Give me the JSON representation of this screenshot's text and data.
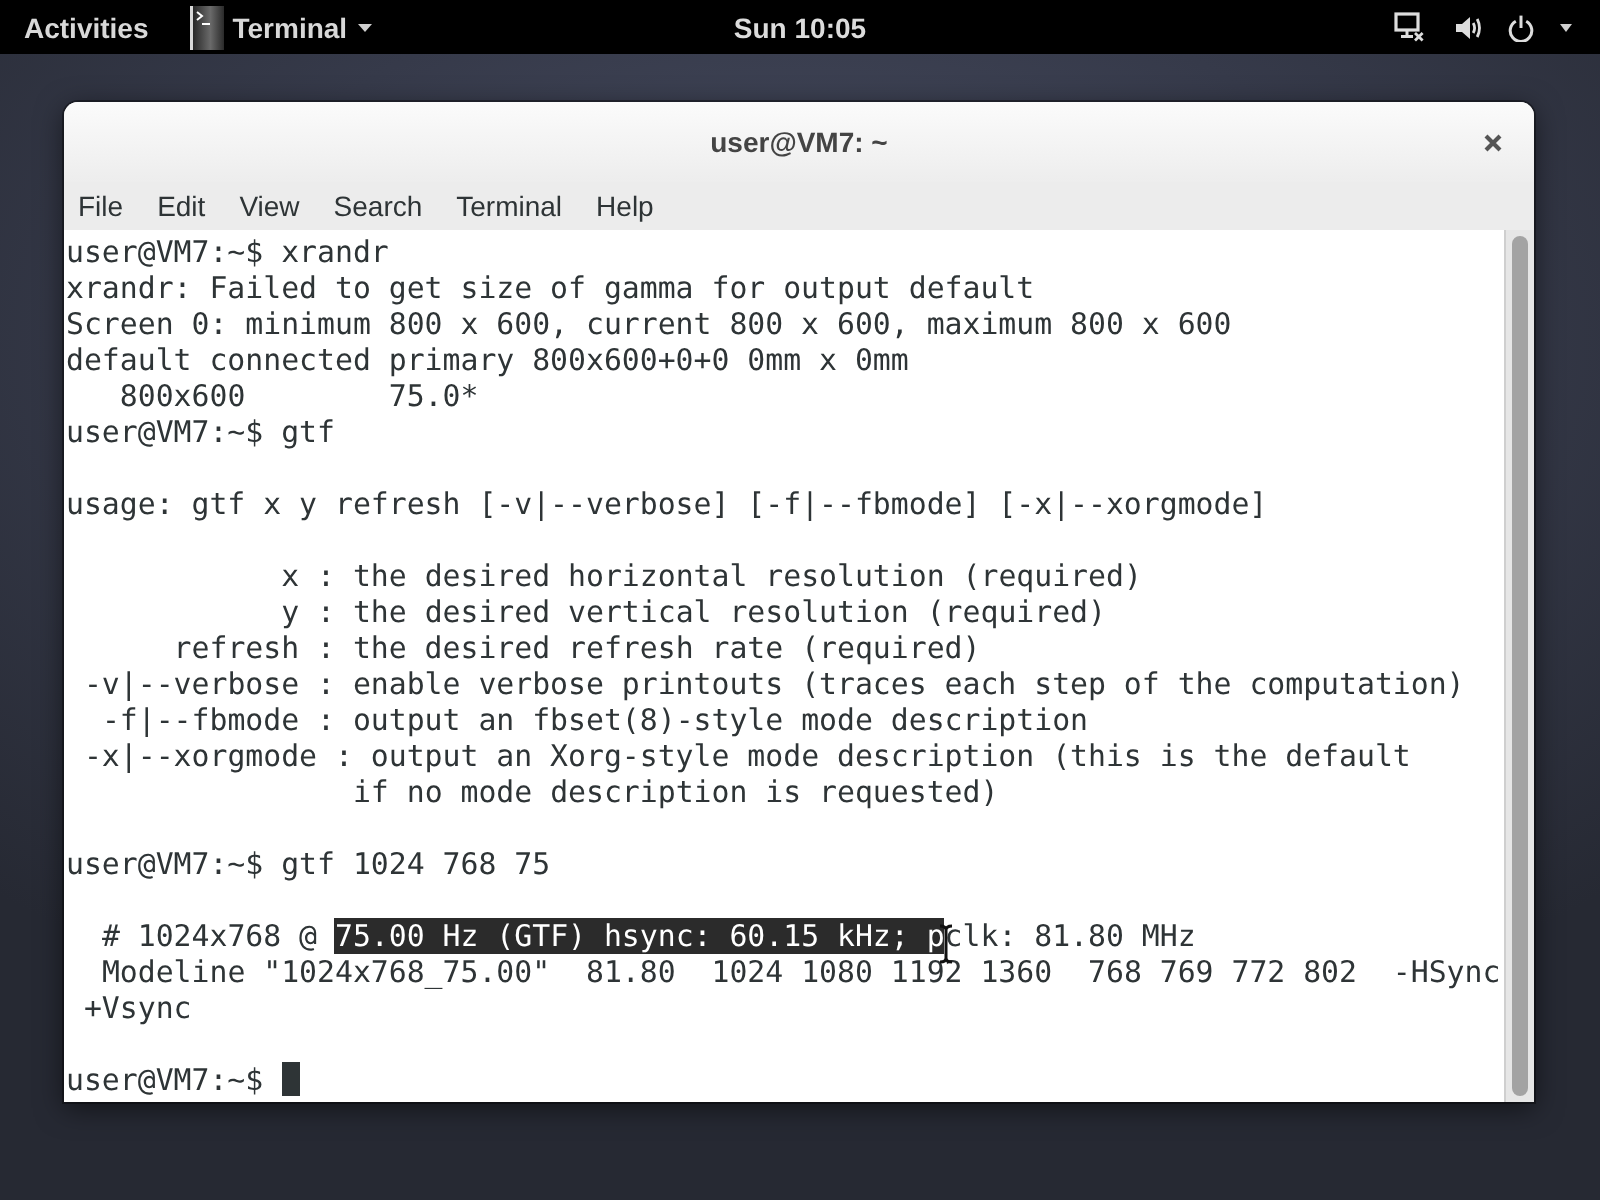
{
  "top_bar": {
    "activities": "Activities",
    "app_menu": "Terminal",
    "clock": "Sun 10:05"
  },
  "window": {
    "title": "user@VM7: ~",
    "menu": [
      "File",
      "Edit",
      "View",
      "Search",
      "Terminal",
      "Help"
    ],
    "terminal": {
      "blocks": [
        [
          "user@VM7:~$ xrandr",
          "xrandr: Failed to get size of gamma for output default",
          "Screen 0: minimum 800 x 600, current 800 x 600, maximum 800 x 600",
          "default connected primary 800x600+0+0 0mm x 0mm",
          "   800x600        75.0*",
          "user@VM7:~$ gtf"
        ],
        [
          "usage: gtf x y refresh [-v|--verbose] [-f|--fbmode] [-x|--xorgmode]"
        ],
        [
          "            x : the desired horizontal resolution (required)",
          "            y : the desired vertical resolution (required)",
          "      refresh : the desired refresh rate (required)",
          " -v|--verbose : enable verbose printouts (traces each step of the computation)",
          "  -f|--fbmode : output an fbset(8)-style mode description",
          " -x|--xorgmode : output an Xorg-style mode description (this is the default",
          "                if no mode description is requested)"
        ],
        [
          "user@VM7:~$ gtf 1024 768 75"
        ],
        [
          {
            "segments": [
              {
                "text": "  # 1024x768 @ ",
                "selected": false
              },
              {
                "text": "75.00 Hz (GTF) hsync: 60.15 kHz; p",
                "selected": true
              },
              {
                "text": "clk: 81.80 MHz",
                "selected": false
              }
            ]
          },
          "  Modeline \"1024x768_75.00\"  81.80  1024 1080 1192 1360  768 769 772 802  -HSync",
          " +Vsync"
        ],
        [
          "user@VM7:~$"
        ]
      ],
      "cursor": true
    }
  }
}
